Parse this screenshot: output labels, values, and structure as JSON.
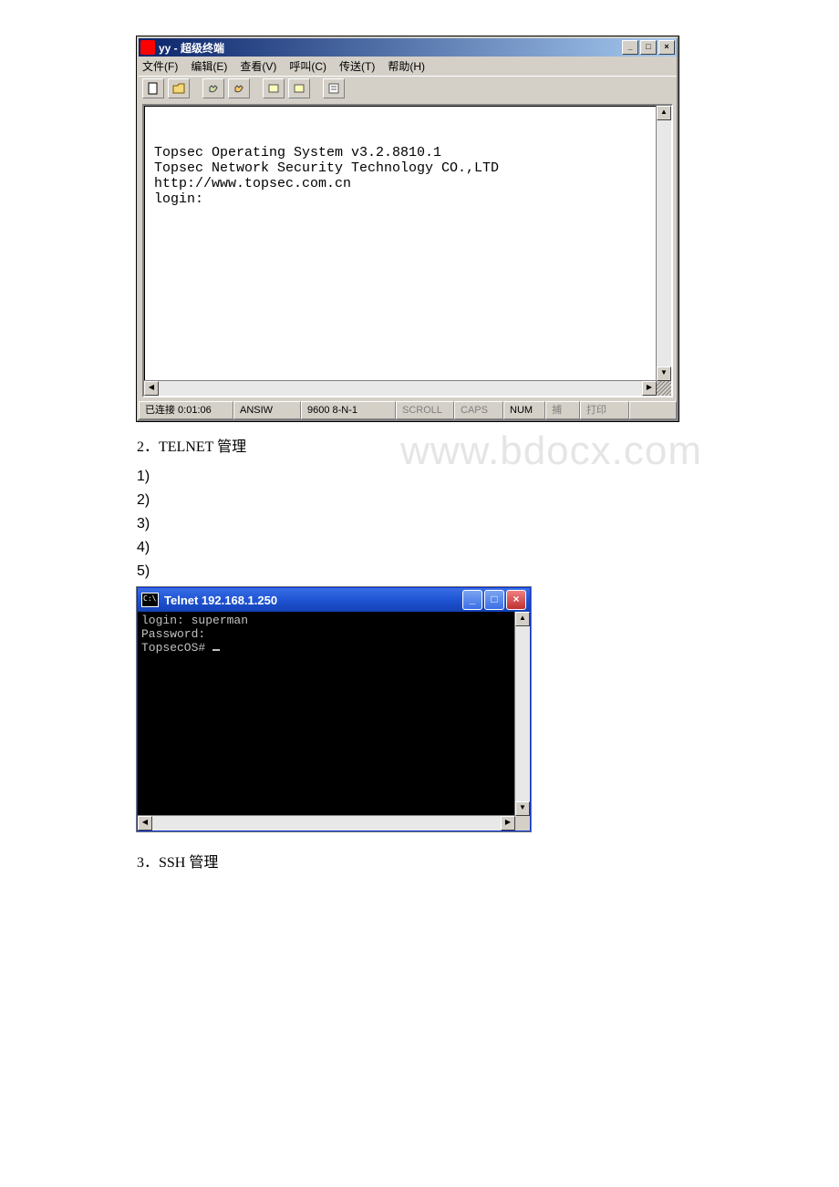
{
  "hyperterm": {
    "title": "yy - 超级终端",
    "menu": {
      "file": "文件(F)",
      "edit": "编辑(E)",
      "view": "查看(V)",
      "call": "呼叫(C)",
      "transfer": "传送(T)",
      "help": "帮助(H)"
    },
    "terminal_lines": [
      "",
      "Topsec Operating System v3.2.8810.1",
      "Topsec Network Security Technology CO.,LTD",
      "http://www.topsec.com.cn",
      "login:"
    ],
    "status": {
      "connected": "已连接 0:01:06",
      "emulation": "ANSIW",
      "params": "9600 8-N-1",
      "scroll": "SCROLL",
      "caps": "CAPS",
      "num": "NUM",
      "capture": "捕",
      "print": "打印"
    }
  },
  "section2": {
    "heading": "2．TELNET 管理",
    "items": [
      "1)",
      "2)",
      "3)",
      "4)",
      "5)"
    ]
  },
  "watermark": "www.bdocx.com",
  "telnet": {
    "title": "Telnet 192.168.1.250",
    "cmdicon_text": "C:\\",
    "lines": [
      "login: superman",
      "Password:",
      "TopsecOS# "
    ]
  },
  "section3": {
    "heading": "3．SSH 管理"
  },
  "winbuttons": {
    "min": "_",
    "max": "□",
    "close": "×"
  },
  "scroll_arrows": {
    "up": "▲",
    "down": "▼",
    "left": "◀",
    "right": "▶"
  }
}
